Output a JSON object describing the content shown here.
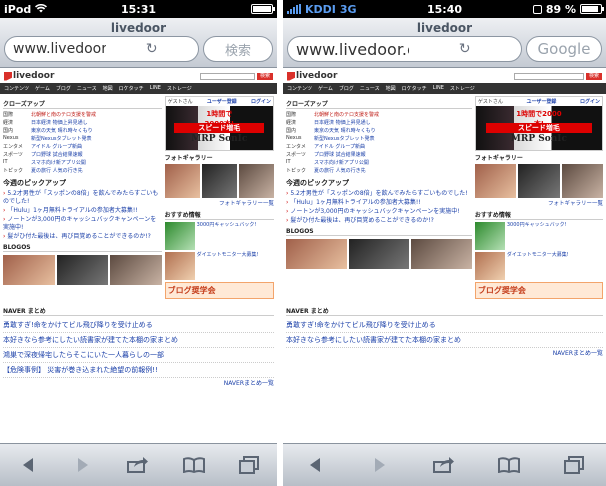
{
  "phones": [
    {
      "status": {
        "carrier": "iPod",
        "time": "15:31",
        "battery_percent": "",
        "network": ""
      },
      "site_title": "livedoor",
      "url": "www.livedoor.com/?igno",
      "search_placeholder": "検索",
      "page": {
        "logo": "livedoor",
        "search_button": "検索",
        "nav": [
          "コンテンツ",
          "ゲーム",
          "ブログ",
          "ニュース",
          "地図",
          "ロケタッチ",
          "LINE",
          "ストレージ"
        ],
        "closeup_title": "クローズアップ",
        "closeup_rows": [
          {
            "label": "国際",
            "text": "北朝鮮と南のテロ支援を警戒"
          },
          {
            "label": "経済",
            "text": "日本経済 物価上昇見通し"
          },
          {
            "label": "国内",
            "text": "東京の天気 晴れ時々くもり"
          },
          {
            "label": "Nexus",
            "text": "新型Nexusタブレット発表"
          },
          {
            "label": "エンタメ",
            "text": "アイドル グループ新曲"
          },
          {
            "label": "スポーツ",
            "text": "プロ野球 試合結果速報"
          },
          {
            "label": "IT",
            "text": "スマホ向け新アプリ公開"
          },
          {
            "label": "トピック",
            "text": "夏の旅行 人気の行き先"
          }
        ],
        "pickup_title": "今週のピックアップ",
        "pickup_items": [
          "5.2才男性が「スッポンの8倍」を飲んでみたらすごいものでした!",
          "「Hulu」1ヶ月無料トライアルの参加者大募集!!",
          "ノートンが3,000円のキャッシュバックキャンペーンを実施中!",
          "髪がひ付た最後は、再び目覚めることができるのか!?"
        ],
        "blogos_title": "BLOGOS",
        "naver_title": "NAVER まとめ",
        "naver_items": [
          "勇敢すぎ!命をかけてビル飛び降りを受け止める",
          "本好きなら参考にしたい読書家が建てた本棚の家まとめ",
          "鴻巣で深夜帰宅したらそこにいた一人暮らしの一部",
          "【危険事例】 災害が巻き込まれた絶望の前報例!!"
        ],
        "naver_more": "NAVERまとめ一覧",
        "ad_user": "ゲストさん",
        "ad_register": "ユーザー登録",
        "ad_login": "ログイン",
        "ad_banner_top": "1時間で2000本!",
        "ad_speed": "スピード増毛",
        "ad_product": "MRP SonIc",
        "gallery_title": "フォトギャラリー",
        "gallery_more": "フォトギャラリー一覧",
        "reco_title": "おすすめ情報",
        "reco_items": [
          "3000円キャッシュバック!",
          "ダイエットモニター大募集!"
        ],
        "blog_award": "ブログ奨学会"
      }
    },
    {
      "status": {
        "carrier": "KDDI",
        "network": "3G",
        "time": "15:40",
        "battery_percent": "89 %"
      },
      "site_title": "livedoor",
      "url": "www.livedoor.com/?igno",
      "search_placeholder": "Google",
      "page": {
        "logo": "livedoor",
        "search_button": "検索",
        "nav": [
          "コンテンツ",
          "ゲーム",
          "ブログ",
          "ニュース",
          "地図",
          "ロケタッチ",
          "LINE",
          "ストレージ"
        ],
        "closeup_title": "クローズアップ",
        "closeup_rows": [
          {
            "label": "国際",
            "text": "北朝鮮と南のテロ支援を警戒"
          },
          {
            "label": "経済",
            "text": "日本経済 物価上昇見通し"
          },
          {
            "label": "国内",
            "text": "東京の天気 晴れ時々くもり"
          },
          {
            "label": "Nexus",
            "text": "新型Nexusタブレット発表"
          },
          {
            "label": "エンタメ",
            "text": "アイドル グループ新曲"
          },
          {
            "label": "スポーツ",
            "text": "プロ野球 試合結果速報"
          },
          {
            "label": "IT",
            "text": "スマホ向け新アプリ公開"
          },
          {
            "label": "トピック",
            "text": "夏の旅行 人気の行き先"
          }
        ],
        "pickup_title": "今週のピックアップ",
        "pickup_items": [
          "5.2才男性が「スッポンの8倍」を飲んでみたらすごいものでした!",
          "「Hulu」1ヶ月無料トライアルの参加者大募集!!",
          "ノートンが3,000円のキャッシュバックキャンペーンを実施中!",
          "髪がひ付た最後は、再び目覚めることができるのか!?"
        ],
        "blogos_title": "BLOGOS",
        "naver_title": "NAVER まとめ",
        "naver_items": [
          "勇敢すぎ!命をかけてビル飛び降りを受け止める",
          "本好きなら参考にしたい読書家が建てた本棚の家まとめ"
        ],
        "naver_more": "NAVERまとめ一覧",
        "ad_user": "ゲストさん",
        "ad_register": "ユーザー登録",
        "ad_login": "ログイン",
        "ad_banner_top": "1時間で2000本!",
        "ad_speed": "スピード増毛",
        "ad_product": "MRP SonIc",
        "gallery_title": "フォトギャラリー",
        "gallery_more": "フォトギャラリー一覧",
        "reco_title": "おすすめ情報",
        "reco_items": [
          "3000円キャッシュバック!",
          "ダイエットモニター大募集!"
        ],
        "blog_award": "ブログ奨学会"
      }
    }
  ],
  "toolbar_icons": [
    "back-icon",
    "forward-icon",
    "share-icon",
    "bookmarks-icon",
    "tabs-icon"
  ]
}
